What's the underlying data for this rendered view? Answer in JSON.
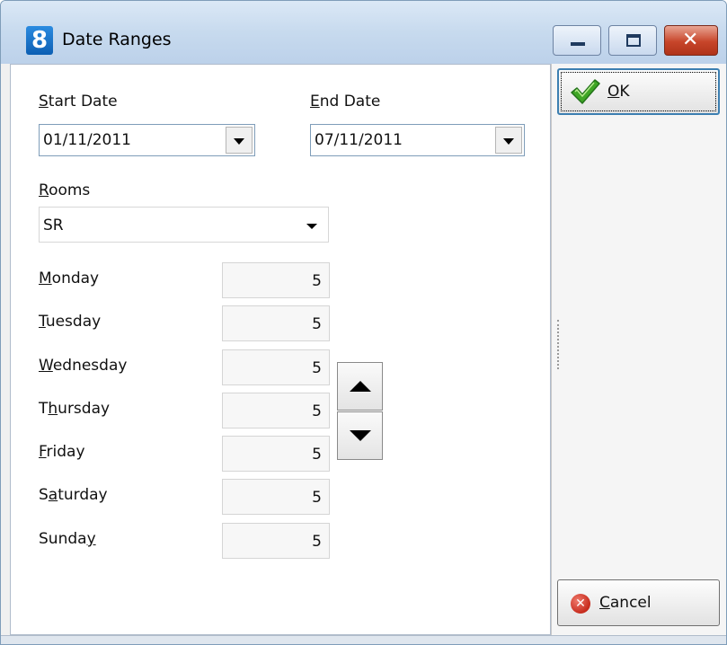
{
  "window": {
    "title": "Date Ranges",
    "app_icon_text": "8",
    "close_glyph": "✕"
  },
  "start_date": {
    "label_ul": "S",
    "label_rest": "tart Date",
    "value": "01/11/2011"
  },
  "end_date": {
    "label_ul": "E",
    "label_rest": "nd Date",
    "value": "07/11/2011"
  },
  "rooms": {
    "label_ul": "R",
    "label_rest": "ooms",
    "value": "SR"
  },
  "days": {
    "monday": {
      "pre": "",
      "ul": "M",
      "post": "onday",
      "value": "5"
    },
    "tuesday": {
      "pre": "",
      "ul": "T",
      "post": "uesday",
      "value": "5"
    },
    "wednesday": {
      "pre": "",
      "ul": "W",
      "post": "ednesday",
      "value": "5"
    },
    "thursday": {
      "pre": "T",
      "ul": "h",
      "post": "ursday",
      "value": "5"
    },
    "friday": {
      "pre": "",
      "ul": "F",
      "post": "riday",
      "value": "5"
    },
    "saturday": {
      "pre": "S",
      "ul": "a",
      "post": "turday",
      "value": "5"
    },
    "sunday": {
      "pre": "Sunda",
      "ul": "y",
      "post": "",
      "value": "5"
    }
  },
  "buttons": {
    "ok": {
      "ul": "O",
      "rest": "K",
      "icon": "checkmark-icon"
    },
    "cancel": {
      "ul": "C",
      "rest": "ancel",
      "icon": "cancel-icon",
      "icon_glyph": "✕"
    }
  },
  "colors": {
    "ok_check": "#3fa626",
    "cancel_red": "#c62b1d"
  }
}
